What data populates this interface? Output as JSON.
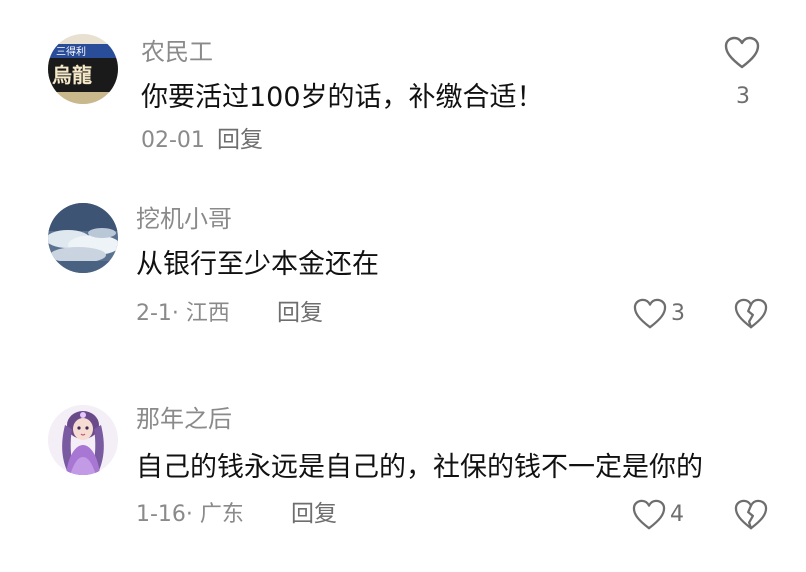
{
  "comments": [
    {
      "username": "农民工",
      "avatar_text_top": "三得利",
      "avatar_text_bottom": "烏龍",
      "content": "你要活过100岁的话，补缴合适！",
      "meta": "02-01",
      "reply_label": "回复",
      "like_count": "3"
    },
    {
      "username": "挖机小哥",
      "content": "从银行至少本金还在",
      "meta": "2-1· 江西",
      "reply_label": "回复",
      "like_count": "3"
    },
    {
      "username": "那年之后",
      "content": "自己的钱永远是自己的，社保的钱不一定是你的",
      "meta": "1-16· 广东",
      "reply_label": "回复",
      "like_count": "4"
    }
  ],
  "icons": {
    "like": "heart-outline-icon",
    "dislike": "broken-heart-icon"
  },
  "colors": {
    "username": "#8a8a8a",
    "content": "#111111",
    "meta": "#8a8a8a",
    "icon": "#6e6e6e"
  }
}
